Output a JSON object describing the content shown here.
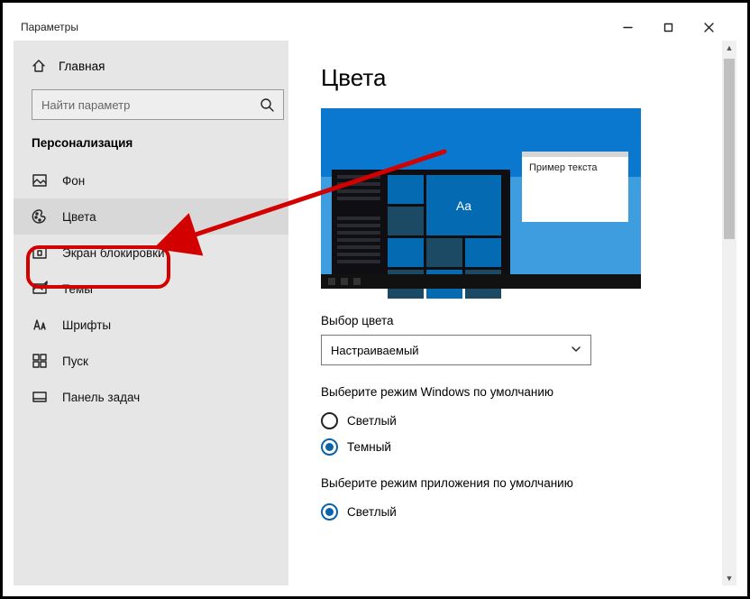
{
  "window": {
    "title": "Параметры"
  },
  "sidebar": {
    "home": "Главная",
    "search_placeholder": "Найти параметр",
    "section": "Персонализация",
    "items": [
      {
        "label": "Фон"
      },
      {
        "label": "Цвета"
      },
      {
        "label": "Экран блокировки"
      },
      {
        "label": "Темы"
      },
      {
        "label": "Шрифты"
      },
      {
        "label": "Пуск"
      },
      {
        "label": "Панель задач"
      }
    ]
  },
  "main": {
    "title": "Цвета",
    "preview_tile_text": "Aa",
    "preview_window_text": "Пример текста",
    "color_mode_label": "Выбор цвета",
    "color_mode_value": "Настраиваемый",
    "windows_mode_label": "Выберите режим Windows по умолчанию",
    "windows_mode_options": {
      "light": "Светлый",
      "dark": "Темный"
    },
    "app_mode_label": "Выберите режим приложения по умолчанию",
    "app_mode_options": {
      "light": "Светлый"
    }
  }
}
